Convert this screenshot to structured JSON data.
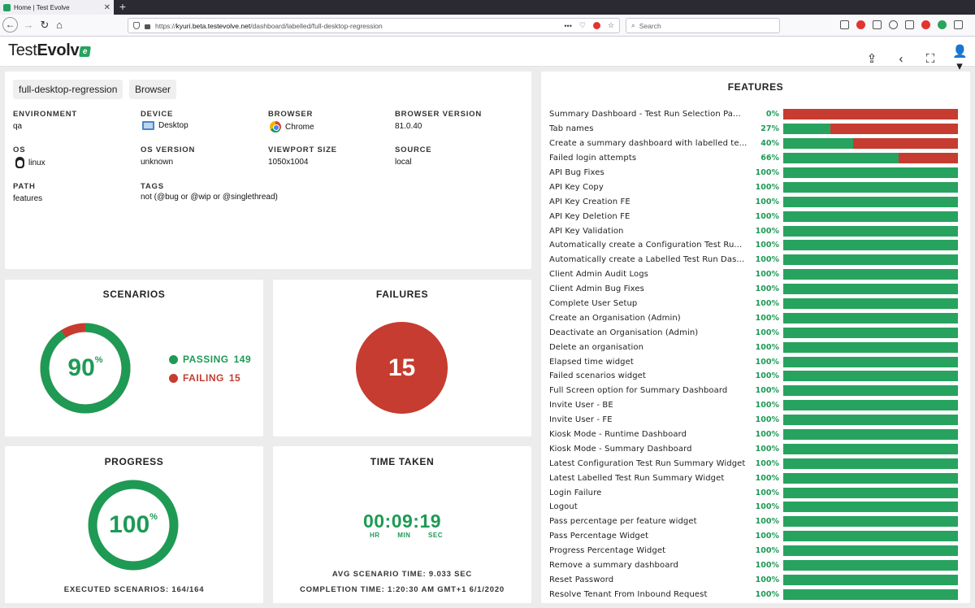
{
  "browser": {
    "tab_title": "Home | Test Evolve",
    "url_domain": "kyuri.beta.testevolve.net",
    "url_prefix": "https://",
    "url_path": "/dashboard/labelled/full-desktop-regression",
    "search_placeholder": "Search"
  },
  "app": {
    "logo_light": "Test",
    "logo_bold": "Evolv",
    "logo_mark": "e"
  },
  "info": {
    "chips": [
      "full-desktop-regression",
      "Browser"
    ],
    "fields": [
      {
        "label": "ENVIRONMENT",
        "value": "qa",
        "icon": ""
      },
      {
        "label": "DEVICE",
        "value": "Desktop",
        "icon": "monitor-icon"
      },
      {
        "label": "BROWSER",
        "value": "Chrome",
        "icon": "chrome-icon"
      },
      {
        "label": "BROWSER VERSION",
        "value": "81.0.40",
        "icon": ""
      },
      {
        "label": "OS",
        "value": "linux",
        "icon": "linux-icon"
      },
      {
        "label": "OS VERSION",
        "value": "unknown",
        "icon": ""
      },
      {
        "label": "VIEWPORT SIZE",
        "value": "1050x1004",
        "icon": ""
      },
      {
        "label": "SOURCE",
        "value": "local",
        "icon": ""
      },
      {
        "label": "PATH",
        "value": "features",
        "icon": ""
      },
      {
        "label": "TAGS",
        "value": "not (@bug or @wip or @singlethread)",
        "icon": ""
      }
    ]
  },
  "scenarios": {
    "title": "SCENARIOS",
    "pct": "90",
    "pct_sign": "%",
    "pass_fraction": 0.9085,
    "passing_label": "PASSING",
    "passing_count": "149",
    "failing_label": "FAILING",
    "failing_count": "15",
    "pass_color": "#1e9a55",
    "fail_color": "#c63c30"
  },
  "failures": {
    "title": "FAILURES",
    "count": "15"
  },
  "progress": {
    "title": "PROGRESS",
    "pct": "100",
    "pct_sign": "%",
    "fraction": 1.0,
    "executed": "EXECUTED SCENARIOS: 164/164"
  },
  "time": {
    "title": "TIME TAKEN",
    "clock": "00:09:19",
    "units": [
      "HR",
      "MIN",
      "SEC"
    ],
    "avg": "AVG SCENARIO TIME: 9.033 SEC",
    "completion": "COMPLETION TIME: 1:20:30 AM GMT+1 6/1/2020"
  },
  "features": {
    "title": "FEATURES",
    "items": [
      {
        "name": "Summary Dashboard - Test Run Selection Pa...",
        "pct": "0%",
        "pass": 0.0
      },
      {
        "name": "Tab names",
        "pct": "27%",
        "pass": 0.27
      },
      {
        "name": "Create a summary dashboard with labelled te...",
        "pct": "40%",
        "pass": 0.4
      },
      {
        "name": "Failed login attempts",
        "pct": "66%",
        "pass": 0.66
      },
      {
        "name": "API Bug Fixes",
        "pct": "100%",
        "pass": 1.0
      },
      {
        "name": "API Key Copy",
        "pct": "100%",
        "pass": 1.0
      },
      {
        "name": "API Key Creation FE",
        "pct": "100%",
        "pass": 1.0
      },
      {
        "name": "API Key Deletion FE",
        "pct": "100%",
        "pass": 1.0
      },
      {
        "name": "API Key Validation",
        "pct": "100%",
        "pass": 1.0
      },
      {
        "name": "Automatically create a Configuration Test Ru...",
        "pct": "100%",
        "pass": 1.0
      },
      {
        "name": "Automatically create a Labelled Test Run Das...",
        "pct": "100%",
        "pass": 1.0
      },
      {
        "name": "Client Admin Audit Logs",
        "pct": "100%",
        "pass": 1.0
      },
      {
        "name": "Client Admin Bug Fixes",
        "pct": "100%",
        "pass": 1.0
      },
      {
        "name": "Complete User Setup",
        "pct": "100%",
        "pass": 1.0
      },
      {
        "name": "Create an Organisation (Admin)",
        "pct": "100%",
        "pass": 1.0
      },
      {
        "name": "Deactivate an Organisation (Admin)",
        "pct": "100%",
        "pass": 1.0
      },
      {
        "name": "Delete an organisation",
        "pct": "100%",
        "pass": 1.0
      },
      {
        "name": "Elapsed time widget",
        "pct": "100%",
        "pass": 1.0
      },
      {
        "name": "Failed scenarios widget",
        "pct": "100%",
        "pass": 1.0
      },
      {
        "name": "Full Screen option for Summary Dashboard",
        "pct": "100%",
        "pass": 1.0
      },
      {
        "name": "Invite User - BE",
        "pct": "100%",
        "pass": 1.0
      },
      {
        "name": "Invite User - FE",
        "pct": "100%",
        "pass": 1.0
      },
      {
        "name": "Kiosk Mode - Runtime Dashboard",
        "pct": "100%",
        "pass": 1.0
      },
      {
        "name": "Kiosk Mode - Summary Dashboard",
        "pct": "100%",
        "pass": 1.0
      },
      {
        "name": "Latest Configuration Test Run Summary Widget",
        "pct": "100%",
        "pass": 1.0
      },
      {
        "name": "Latest Labelled Test Run Summary Widget",
        "pct": "100%",
        "pass": 1.0
      },
      {
        "name": "Login Failure",
        "pct": "100%",
        "pass": 1.0
      },
      {
        "name": "Logout",
        "pct": "100%",
        "pass": 1.0
      },
      {
        "name": "Pass percentage per feature widget",
        "pct": "100%",
        "pass": 1.0
      },
      {
        "name": "Pass Percentage Widget",
        "pct": "100%",
        "pass": 1.0
      },
      {
        "name": "Progress Percentage Widget",
        "pct": "100%",
        "pass": 1.0
      },
      {
        "name": "Remove a summary dashboard",
        "pct": "100%",
        "pass": 1.0
      },
      {
        "name": "Reset Password",
        "pct": "100%",
        "pass": 1.0
      },
      {
        "name": "Resolve Tenant From Inbound Request",
        "pct": "100%",
        "pass": 1.0
      }
    ]
  }
}
